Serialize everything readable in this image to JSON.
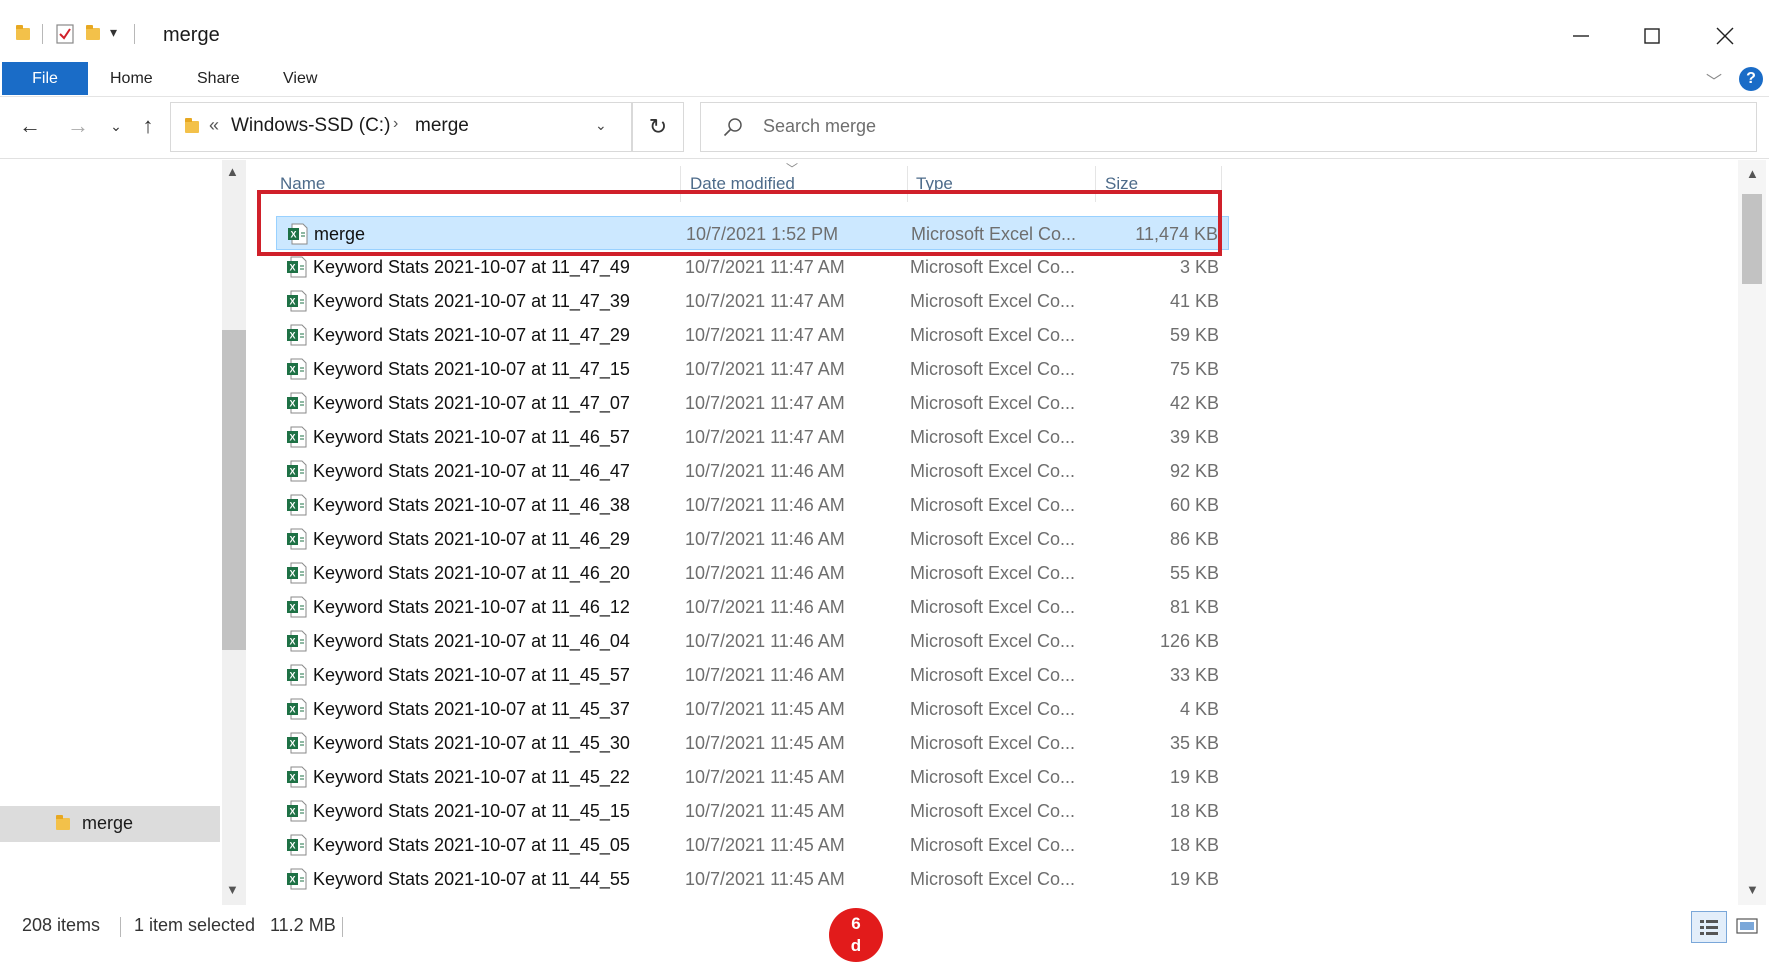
{
  "window": {
    "title": "merge",
    "controls": [
      "minimize-icon",
      "maximize-icon",
      "close-icon"
    ]
  },
  "ribbon": {
    "tabs": [
      {
        "label": "File",
        "active": true
      },
      {
        "label": "Home"
      },
      {
        "label": "Share"
      },
      {
        "label": "View"
      }
    ],
    "help_label": "?"
  },
  "nav": {
    "breadcrumb": [
      "Windows-SSD (C:)",
      "merge"
    ],
    "overflow": "«",
    "search_placeholder": "Search merge"
  },
  "sidebar": {
    "items": [
      {
        "label": "merge",
        "selected": true
      }
    ]
  },
  "columns": {
    "name": "Name",
    "date": "Date modified",
    "type": "Type",
    "size": "Size"
  },
  "files": [
    {
      "name": "merge",
      "date": "10/7/2021 1:52 PM",
      "type": "Microsoft Excel Co...",
      "size": "11,474 KB",
      "selected": true
    },
    {
      "name": "Keyword Stats 2021-10-07 at 11_47_49",
      "date": "10/7/2021 11:47 AM",
      "type": "Microsoft Excel Co...",
      "size": "3 KB"
    },
    {
      "name": "Keyword Stats 2021-10-07 at 11_47_39",
      "date": "10/7/2021 11:47 AM",
      "type": "Microsoft Excel Co...",
      "size": "41 KB"
    },
    {
      "name": "Keyword Stats 2021-10-07 at 11_47_29",
      "date": "10/7/2021 11:47 AM",
      "type": "Microsoft Excel Co...",
      "size": "59 KB"
    },
    {
      "name": "Keyword Stats 2021-10-07 at 11_47_15",
      "date": "10/7/2021 11:47 AM",
      "type": "Microsoft Excel Co...",
      "size": "75 KB"
    },
    {
      "name": "Keyword Stats 2021-10-07 at 11_47_07",
      "date": "10/7/2021 11:47 AM",
      "type": "Microsoft Excel Co...",
      "size": "42 KB"
    },
    {
      "name": "Keyword Stats 2021-10-07 at 11_46_57",
      "date": "10/7/2021 11:47 AM",
      "type": "Microsoft Excel Co...",
      "size": "39 KB"
    },
    {
      "name": "Keyword Stats 2021-10-07 at 11_46_47",
      "date": "10/7/2021 11:46 AM",
      "type": "Microsoft Excel Co...",
      "size": "92 KB"
    },
    {
      "name": "Keyword Stats 2021-10-07 at 11_46_38",
      "date": "10/7/2021 11:46 AM",
      "type": "Microsoft Excel Co...",
      "size": "60 KB"
    },
    {
      "name": "Keyword Stats 2021-10-07 at 11_46_29",
      "date": "10/7/2021 11:46 AM",
      "type": "Microsoft Excel Co...",
      "size": "86 KB"
    },
    {
      "name": "Keyword Stats 2021-10-07 at 11_46_20",
      "date": "10/7/2021 11:46 AM",
      "type": "Microsoft Excel Co...",
      "size": "55 KB"
    },
    {
      "name": "Keyword Stats 2021-10-07 at 11_46_12",
      "date": "10/7/2021 11:46 AM",
      "type": "Microsoft Excel Co...",
      "size": "81 KB"
    },
    {
      "name": "Keyword Stats 2021-10-07 at 11_46_04",
      "date": "10/7/2021 11:46 AM",
      "type": "Microsoft Excel Co...",
      "size": "126 KB"
    },
    {
      "name": "Keyword Stats 2021-10-07 at 11_45_57",
      "date": "10/7/2021 11:46 AM",
      "type": "Microsoft Excel Co...",
      "size": "33 KB"
    },
    {
      "name": "Keyword Stats 2021-10-07 at 11_45_37",
      "date": "10/7/2021 11:45 AM",
      "type": "Microsoft Excel Co...",
      "size": "4 KB"
    },
    {
      "name": "Keyword Stats 2021-10-07 at 11_45_30",
      "date": "10/7/2021 11:45 AM",
      "type": "Microsoft Excel Co...",
      "size": "35 KB"
    },
    {
      "name": "Keyword Stats 2021-10-07 at 11_45_22",
      "date": "10/7/2021 11:45 AM",
      "type": "Microsoft Excel Co...",
      "size": "19 KB"
    },
    {
      "name": "Keyword Stats 2021-10-07 at 11_45_15",
      "date": "10/7/2021 11:45 AM",
      "type": "Microsoft Excel Co...",
      "size": "18 KB"
    },
    {
      "name": "Keyword Stats 2021-10-07 at 11_45_05",
      "date": "10/7/2021 11:45 AM",
      "type": "Microsoft Excel Co...",
      "size": "18 KB"
    },
    {
      "name": "Keyword Stats 2021-10-07 at 11_44_55",
      "date": "10/7/2021 11:45 AM",
      "type": "Microsoft Excel Co...",
      "size": "19 KB"
    }
  ],
  "status": {
    "items": "208 items",
    "selected": "1 item selected",
    "size": "11.2 MB"
  },
  "annotation": {
    "line1": "6",
    "line2": "d"
  },
  "colors": {
    "accent": "#1a6cc7",
    "selection": "#cce8ff",
    "highlight": "#d0202a",
    "excel": "#1e7145"
  }
}
